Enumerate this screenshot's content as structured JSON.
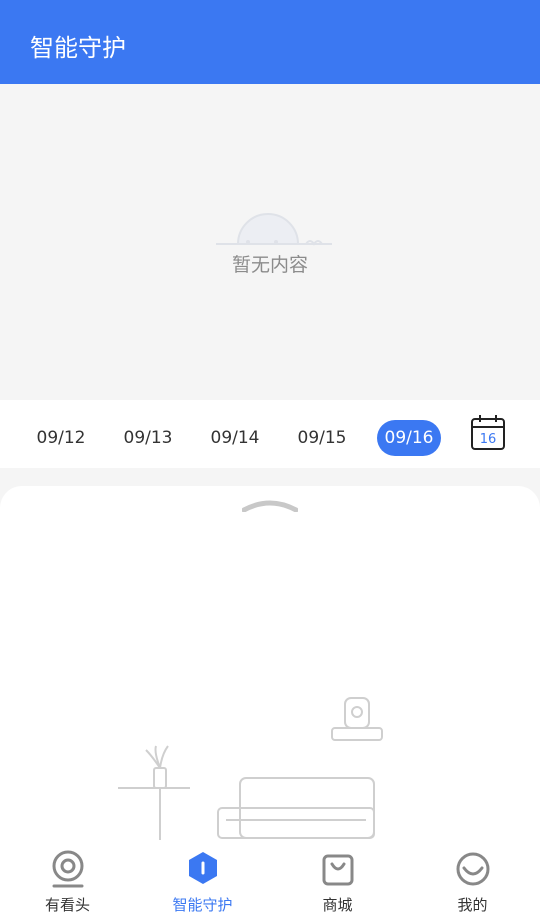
{
  "header": {
    "title": "智能守护"
  },
  "empty_state": {
    "text": "暂无内容"
  },
  "dates": [
    "09/12",
    "09/13",
    "09/14",
    "09/15",
    "09/16"
  ],
  "selected_date": "09/16",
  "calendar": {
    "day": "16"
  },
  "colors": {
    "accent": "#3b78f2",
    "background": "#f5f5f5"
  },
  "tabs": [
    {
      "label": "有看头",
      "icon": "camera-icon"
    },
    {
      "label": "智能守护",
      "icon": "shield-icon"
    },
    {
      "label": "商城",
      "icon": "shopping-bag-icon"
    },
    {
      "label": "我的",
      "icon": "smile-icon"
    }
  ],
  "active_tab": "智能守护"
}
